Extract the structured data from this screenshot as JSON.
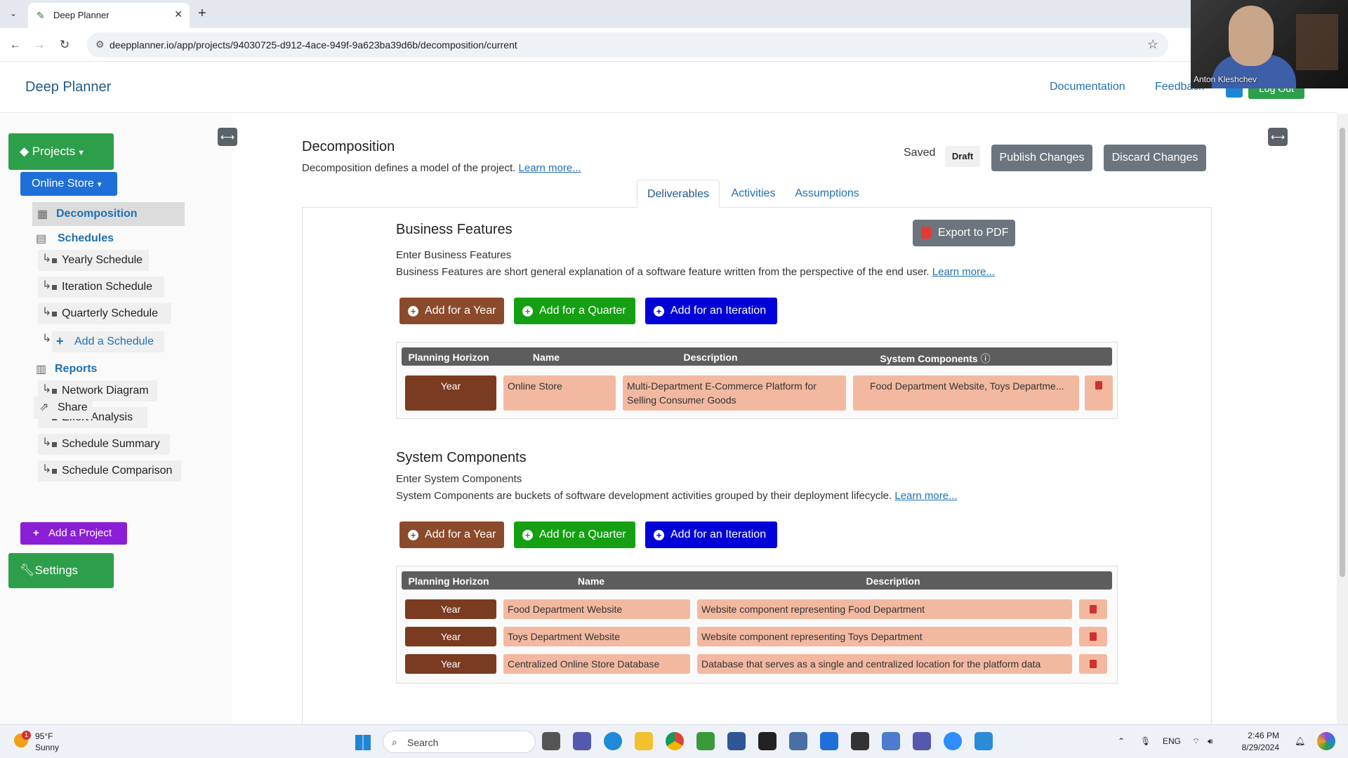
{
  "browser": {
    "tab_title": "Deep Planner",
    "url": "deepplanner.io/app/projects/94030725-d912-4ace-949f-9a623ba39d6b/decomposition/current"
  },
  "video": {
    "name": "Anton Kleshchev"
  },
  "header": {
    "brand": "Deep Planner",
    "documentation": "Documentation",
    "feedback": "Feedback",
    "logout": "Log Out"
  },
  "sidebar": {
    "projects": "Projects",
    "project_name": "Online Store",
    "decomposition": "Decomposition",
    "schedules": "Schedules",
    "schedule_items": [
      "Yearly Schedule",
      "Iteration Schedule",
      "Quarterly Schedule"
    ],
    "add_schedule": "Add a Schedule",
    "reports": "Reports",
    "report_items": [
      "Network Diagram",
      "Effort Analysis",
      "Schedule Summary",
      "Schedule Comparison"
    ],
    "share": "Share",
    "add_project": "Add a Project",
    "settings": "Settings"
  },
  "main": {
    "title": "Decomposition",
    "description": "Decomposition defines a model of the project.",
    "learn_more": "Learn more...",
    "saved": "Saved",
    "draft": "Draft",
    "publish": "Publish Changes",
    "discard": "Discard Changes",
    "tabs": [
      "Deliverables",
      "Activities",
      "Assumptions"
    ]
  },
  "business_features": {
    "title": "Business Features",
    "export": "Export to PDF",
    "enter_text": "Enter Business Features",
    "description": "Business Features are short general explanation of a software feature written from the perspective of the end user.",
    "learn_more": "Learn more...",
    "buttons": [
      "Add for a Year",
      "Add for a Quarter",
      "Add for an Iteration"
    ],
    "columns": [
      "Planning Horizon",
      "Name",
      "Description",
      "System Components"
    ],
    "rows": [
      {
        "horizon": "Year",
        "name": "Online Store",
        "description_line1": "Multi-Department E-Commerce Platform for",
        "description_line2": "Selling Consumer Goods",
        "components": "Food Department Website, Toys Departme..."
      }
    ]
  },
  "system_components": {
    "title": "System Components",
    "enter_text": "Enter System Components",
    "description": "System Components are buckets of software development activities grouped by their deployment lifecycle.",
    "learn_more": "Learn more...",
    "buttons": [
      "Add for a Year",
      "Add for a Quarter",
      "Add for an Iteration"
    ],
    "columns": [
      "Planning Horizon",
      "Name",
      "Description"
    ],
    "rows": [
      {
        "horizon": "Year",
        "name": "Food Department Website",
        "description": "Website component representing Food Department"
      },
      {
        "horizon": "Year",
        "name": "Toys Department Website",
        "description": "Website component representing Toys Department"
      },
      {
        "horizon": "Year",
        "name": "Centralized Online Store Database",
        "description": "Database that serves as a single and centralized location for the platform data"
      }
    ]
  },
  "taskbar": {
    "weather_badge": "1",
    "temperature": "95°F",
    "condition": "Sunny",
    "search": "Search",
    "lang": "ENG",
    "time": "2:46 PM",
    "date": "8/29/2024"
  }
}
